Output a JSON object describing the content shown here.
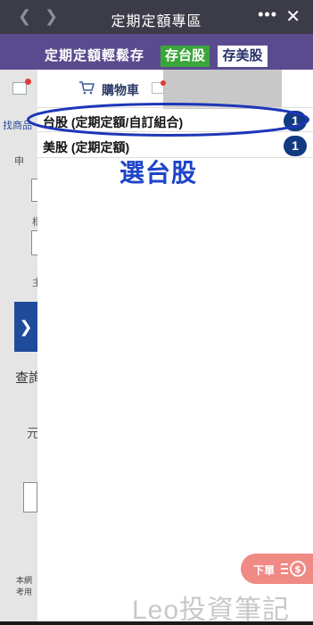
{
  "topbar": {
    "title": "定期定額專區",
    "back_icon": "chevron-left-icon",
    "forward_icon": "chevron-right-icon",
    "more_label": "•••",
    "close_label": "✕"
  },
  "banner": {
    "slogan": "定期定額輕鬆存",
    "tw_button": "存台股",
    "us_button": "存美股",
    "colors": {
      "banner_bg": "#5a4b8f",
      "tw_button_bg": "#3aa63a"
    }
  },
  "background": {
    "tab_label": "找商品",
    "line1": "申",
    "line2": "標",
    "line3": "主",
    "query_label": "查詢",
    "field_label": "元",
    "footer_line1": "本網",
    "footer_line2": "考用"
  },
  "cart": {
    "title": "購物車",
    "icon": "shopping-cart-icon",
    "items": [
      {
        "label": "台股 (定期定額/自訂組合)",
        "count": "1"
      },
      {
        "label": "美股 (定期定額)",
        "count": "1"
      }
    ]
  },
  "annotation": {
    "text": "選台股",
    "color": "#1e44c8"
  },
  "order_button": {
    "label": "下單",
    "icon": "money-list-icon"
  },
  "watermark": "Leo投資筆記"
}
